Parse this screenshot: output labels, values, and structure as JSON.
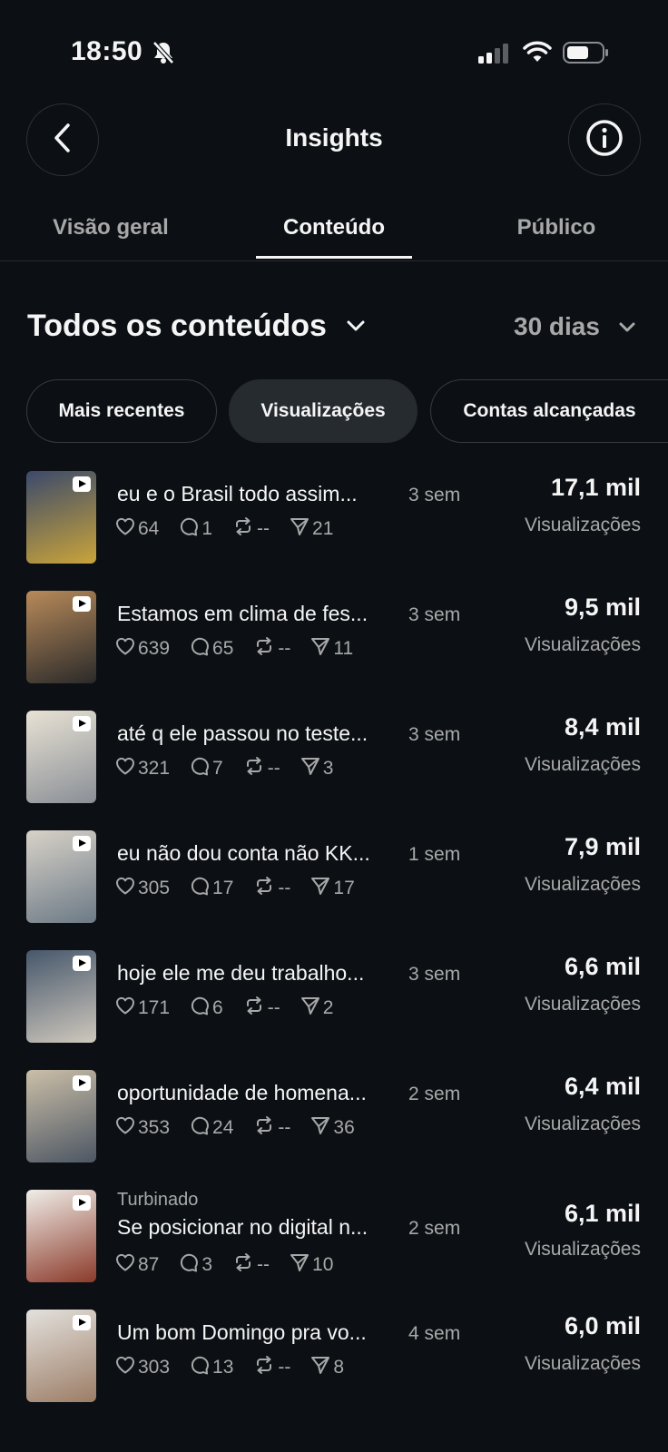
{
  "status": {
    "time": "18:50"
  },
  "header": {
    "title": "Insights"
  },
  "tabs": [
    {
      "label": "Visão geral",
      "active": false
    },
    {
      "label": "Conteúdo",
      "active": true
    },
    {
      "label": "Público",
      "active": false
    }
  ],
  "filter": {
    "title": "Todos os conteúdos",
    "period": "30 dias"
  },
  "sort_chips": [
    {
      "label": "Mais recentes",
      "selected": false
    },
    {
      "label": "Visualizações",
      "selected": true
    },
    {
      "label": "Contas alcançadas",
      "selected": false
    }
  ],
  "posts": [
    {
      "caption": "eu e o Brasil todo assim...",
      "age": "3 sem",
      "likes": "64",
      "comments": "1",
      "reposts": "--",
      "shares": "21",
      "value": "17,1 mil",
      "metric": "Visualizações",
      "thumb": [
        "#3b4a6b",
        "#caa43a"
      ]
    },
    {
      "caption": "Estamos em clima de fes...",
      "age": "3 sem",
      "likes": "639",
      "comments": "65",
      "reposts": "--",
      "shares": "11",
      "value": "9,5 mil",
      "metric": "Visualizações",
      "thumb": [
        "#b88a5a",
        "#2a2a2a"
      ]
    },
    {
      "caption": "até q ele passou no teste...",
      "age": "3 sem",
      "likes": "321",
      "comments": "7",
      "reposts": "--",
      "shares": "3",
      "value": "8,4 mil",
      "metric": "Visualizações",
      "thumb": [
        "#e8e2d4",
        "#8a8f96"
      ]
    },
    {
      "caption": "eu não dou conta não KK...",
      "age": "1 sem",
      "likes": "305",
      "comments": "17",
      "reposts": "--",
      "shares": "17",
      "value": "7,9 mil",
      "metric": "Visualizações",
      "thumb": [
        "#d8d2c8",
        "#6c7a86"
      ]
    },
    {
      "caption": "hoje ele me deu trabalho...",
      "age": "3 sem",
      "likes": "171",
      "comments": "6",
      "reposts": "--",
      "shares": "2",
      "value": "6,6 mil",
      "metric": "Visualizações",
      "thumb": [
        "#46576b",
        "#cfc8bd"
      ]
    },
    {
      "caption": "oportunidade de homena...",
      "age": "2 sem",
      "likes": "353",
      "comments": "24",
      "reposts": "--",
      "shares": "36",
      "value": "6,4 mil",
      "metric": "Visualizações",
      "thumb": [
        "#cbbfa8",
        "#4c5663"
      ]
    },
    {
      "tag": "Turbinado",
      "caption": "Se posicionar no digital n...",
      "age": "2 sem",
      "likes": "87",
      "comments": "3",
      "reposts": "--",
      "shares": "10",
      "value": "6,1 mil",
      "metric": "Visualizações",
      "thumb": [
        "#f0eee9",
        "#8b3a2a"
      ]
    },
    {
      "caption": "Um bom Domingo pra vo...",
      "age": "4 sem",
      "likes": "303",
      "comments": "13",
      "reposts": "--",
      "shares": "8",
      "value": "6,0 mil",
      "metric": "Visualizações",
      "thumb": [
        "#e3e1dd",
        "#9c7d66"
      ]
    }
  ]
}
